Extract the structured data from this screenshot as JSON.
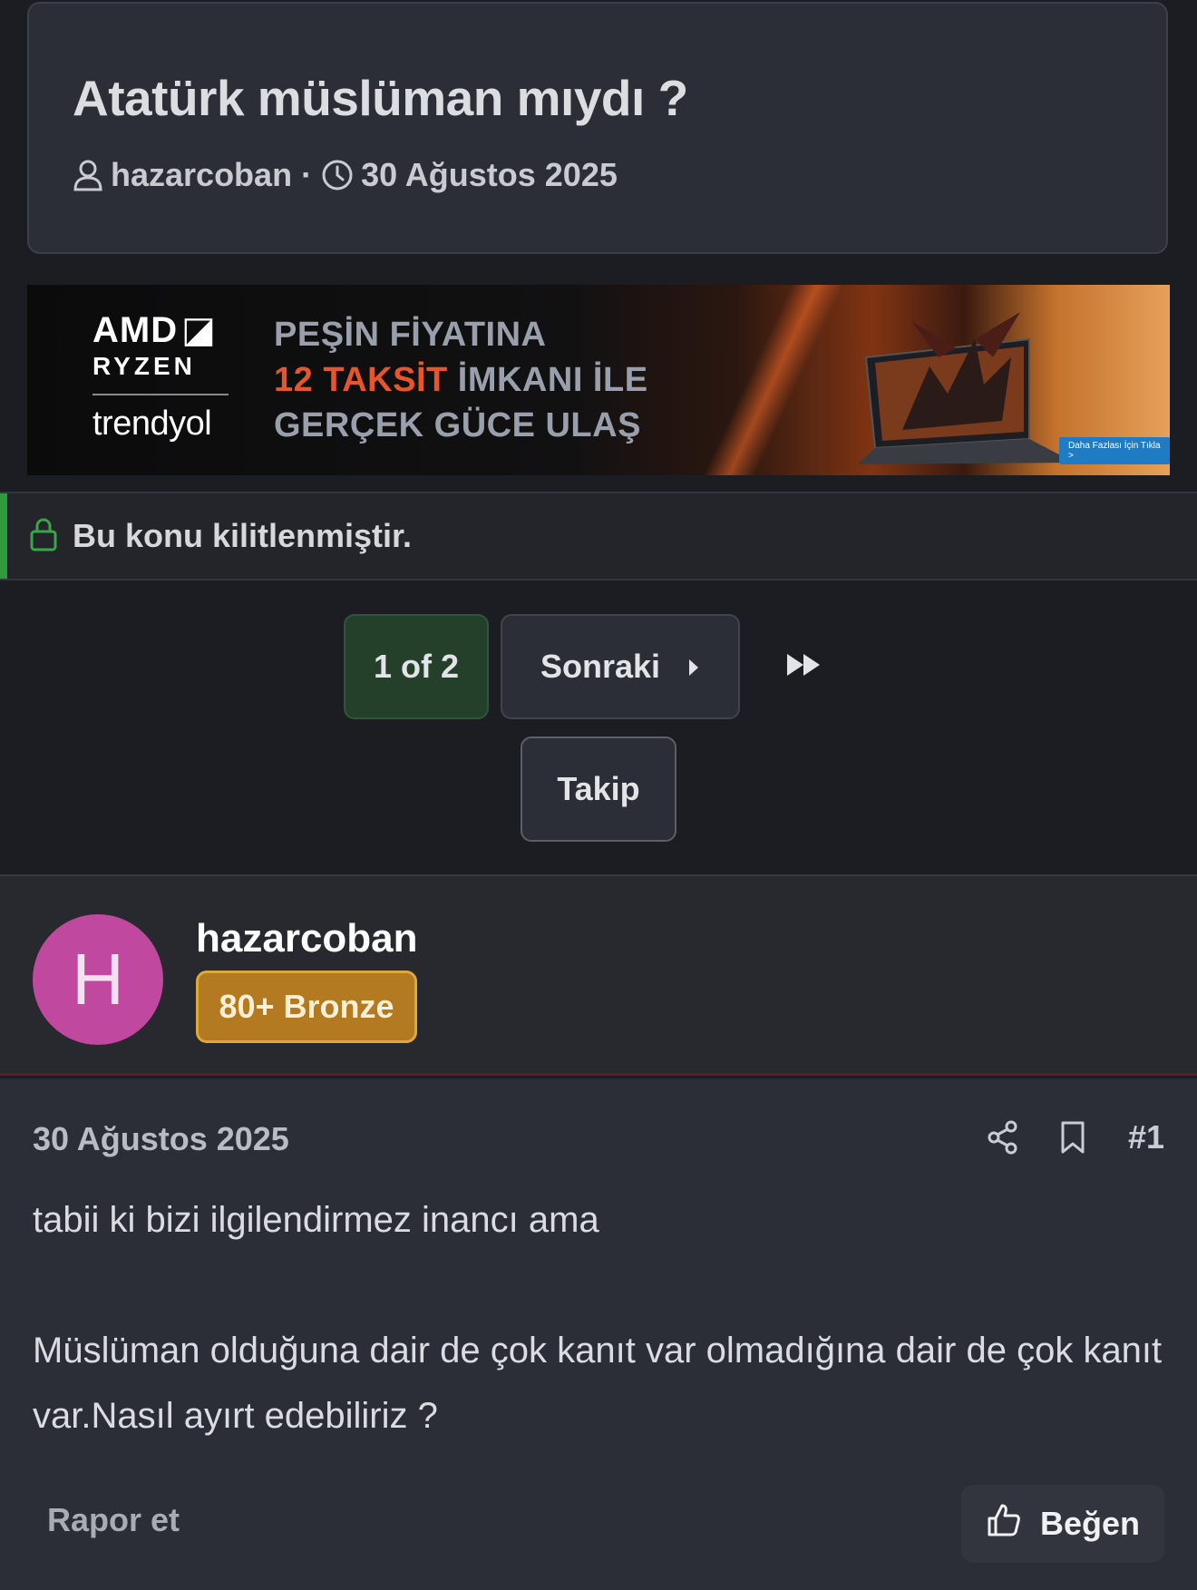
{
  "thread": {
    "title": "Atatürk müslüman mıydı ?",
    "author": "hazarcoban",
    "separator": "·",
    "date": "30 Ağustos 2025"
  },
  "ad": {
    "brand_amd": "AMD",
    "brand_ryzen": "RYZEN",
    "brand_store": "trendyol",
    "line1": "PEŞİN FİYATINA",
    "line2_highlight": "12 TAKSİT",
    "line2_rest": " İMKANI İLE",
    "line3": "GERÇEK GÜCE ULAŞ",
    "cta": "Daha Fazlası İçin Tıkla  >"
  },
  "notice": {
    "locked_text": "Bu konu kilitlenmiştir."
  },
  "pagination": {
    "current": "1 of 2",
    "next_label": "Sonraki"
  },
  "follow": {
    "label": "Takip"
  },
  "author": {
    "initial": "H",
    "name": "hazarcoban",
    "badge": "80+ Bronze",
    "avatar_color": "#c0489e",
    "badge_color": "#b47a22"
  },
  "post": {
    "date": "30 Ağustos 2025",
    "number": "#1",
    "paragraph1": "tabii ki bizi ilgilendirmez inancı ama",
    "paragraph2": "Müslüman olduğuna dair de çok kanıt var olmadığına dair de çok kanıt var.Nasıl ayırt edebiliriz ?",
    "report_label": "Rapor et",
    "like_label": "Beğen"
  },
  "colors": {
    "background": "#1c1d22",
    "accent_green": "#2e9c3c",
    "panel": "#2b2e37"
  },
  "icons": [
    "user-icon",
    "clock-icon",
    "lock-icon",
    "caret-right-icon",
    "fast-forward-icon",
    "share-icon",
    "bookmark-icon",
    "thumbs-up-icon"
  ]
}
